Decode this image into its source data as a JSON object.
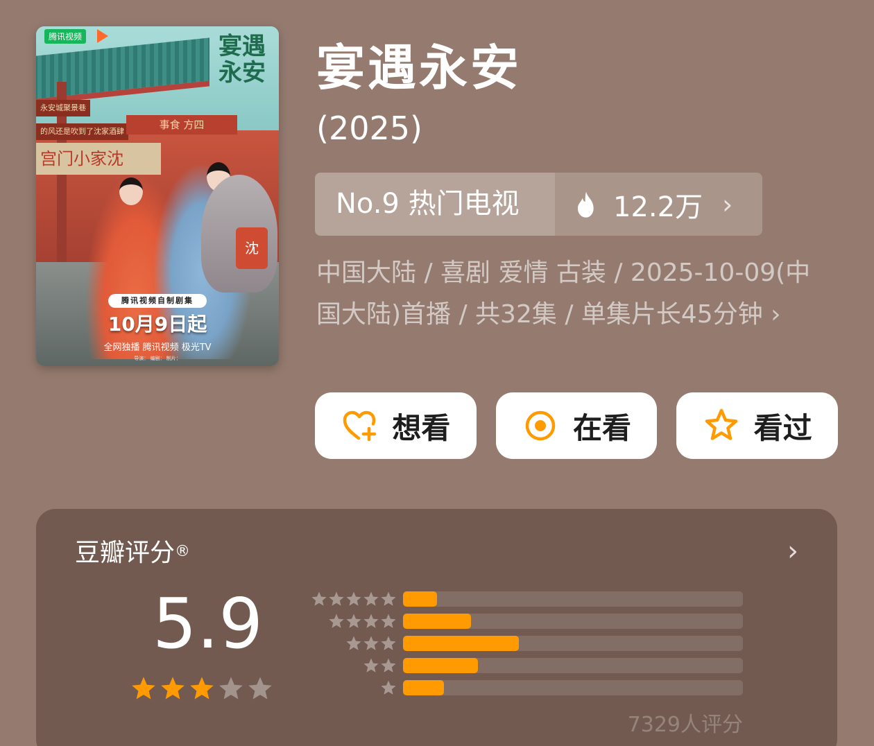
{
  "poster": {
    "brand": "腾讯视频",
    "calligraphy": "宴遇永安",
    "sign_1": "永安城聚景巷",
    "sign_2": "的风还是吹到了沈家酒肆",
    "shop_sign": "宫门小家沈",
    "shop_sign_2": "事食 方四",
    "bib_char": "沈",
    "badge": "腾讯视频自制剧集",
    "date": "10月9日起",
    "platforms": "全网独播  腾讯视频  极光TV",
    "credits": "导演：  编剧：  制片："
  },
  "title": "宴遇永安",
  "year": "(2025)",
  "rank": {
    "label": "No.9 热门电视",
    "heat": "12.2万",
    "chevron": "›",
    "icon": "fire-icon"
  },
  "meta": {
    "text": "中国大陆 / 喜剧 爱情 古装 / 2025-10-09(中国大陆)首播 / 共32集 / 单集片长45分钟 ›"
  },
  "actions": [
    {
      "label": "想看",
      "icon": "heart-plus-icon",
      "color": "#ff9a00"
    },
    {
      "label": "在看",
      "icon": "target-circle-icon",
      "color": "#ff9a00"
    },
    {
      "label": "看过",
      "icon": "star-outline-icon",
      "color": "#ff9a00"
    }
  ],
  "rating": {
    "title": "豆瓣评分",
    "registered": "®",
    "chevron": "›",
    "score": "5.9",
    "stars_filled": 3,
    "stars_total": 5,
    "distribution": [
      {
        "stars": 5,
        "fraction": 0.1
      },
      {
        "stars": 4,
        "fraction": 0.2
      },
      {
        "stars": 3,
        "fraction": 0.34
      },
      {
        "stars": 2,
        "fraction": 0.22
      },
      {
        "stars": 1,
        "fraction": 0.12
      }
    ],
    "count": "7329人评分"
  },
  "colors": {
    "background": "#957b6f",
    "card": "#725a50",
    "accent": "#ff9a00"
  }
}
